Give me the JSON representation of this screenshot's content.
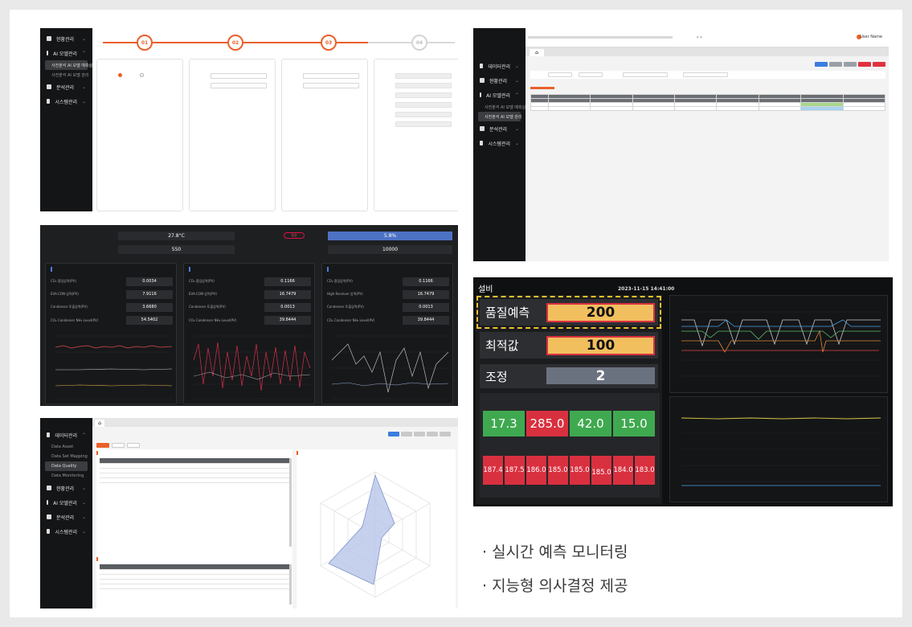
{
  "panel_a": {
    "sidebar": [
      {
        "label": "현황관리"
      },
      {
        "label": "AI 모델관리"
      },
      {
        "label": "분석관리"
      },
      {
        "label": "시스템관리"
      }
    ],
    "sidebar_sub": [
      "사전분석 AI 모델 예측실",
      "사전분석 AI 모델 관리"
    ],
    "steps": [
      "01",
      "02",
      "03",
      "04"
    ]
  },
  "panel_b": {
    "user_name": "User Name",
    "home_tab": "⌂",
    "sidebar": [
      {
        "label": "데이터관리"
      },
      {
        "label": "현황관리"
      },
      {
        "label": "AI 모델관리"
      },
      {
        "label": "분석관리"
      },
      {
        "label": "시스템관리"
      }
    ],
    "sidebar_sub": [
      "사전분석 AI 모델 예측실",
      "사전분석 AI 모델 관리"
    ]
  },
  "panel_c": {
    "top_values": [
      "27.8°C",
      "550",
      "5.8%",
      "10000"
    ],
    "status_badge": "정상",
    "sections": [
      {
        "values": [
          "0.0034",
          "7.9116",
          "3.6680",
          "54.5402"
        ]
      },
      {
        "values": [
          "0.1166",
          "16.7479",
          "0.0013",
          "39.8444"
        ]
      },
      {
        "values": [
          "0.1166",
          "16.7479",
          "0.0013",
          "39.8444"
        ]
      }
    ],
    "section_labels": [
      [
        "CO₂ 흡입압력(PV)",
        "EVA-CON 압력(PV)",
        "Condenser 토출압력(PV)",
        "CO₂ Condenser NH₃ Level(PV)"
      ],
      [
        "CO₂ 흡입압력(PV)",
        "EVA-CON 압력(PV)",
        "Condenser 토출압력(PV)",
        "CO₂ Condenser NH₃ Level(PV)"
      ],
      [
        "CO₂ 흡입압력(PV)",
        "High Receiver 압력(PV)",
        "Condenser 토출압력(PV)",
        "CO₂ Condenser NH₃ Level(PV)"
      ]
    ]
  },
  "panel_d": {
    "home_tab": "⌂",
    "sidebar": [
      {
        "label": "데이터관리"
      },
      {
        "label": "현황관리"
      },
      {
        "label": "AI 모델관리"
      },
      {
        "label": "분석관리"
      },
      {
        "label": "시스템관리"
      }
    ],
    "sidebar_sub": [
      "Data Asset",
      "Data Set Mapping",
      "Data Quality",
      "Data Monitoring"
    ]
  },
  "panel_e": {
    "title": "설비",
    "timestamp": "2023-11-15 14:41:00",
    "quality_label": "품질예측",
    "quality_value": "200",
    "optimal_label": "최적값",
    "optimal_value": "100",
    "adjust_label": "조정",
    "adjust_value": "2",
    "green_values": [
      "17.3",
      "285.0",
      "42.0",
      "15.0"
    ],
    "red_values": [
      "187.4",
      "187.5",
      "186.0",
      "185.0",
      "185.0",
      "185.0",
      "184.0",
      "183.0"
    ]
  },
  "bullets": [
    "· 실시간 예측 모니터링",
    "· 지능형 의사결정 제공"
  ],
  "colors": {
    "accent_orange": "#e9602a",
    "quality_box": "#f2bf5e",
    "adjust_box": "#6a7280",
    "green_cell": "#3fa94f",
    "red_cell": "#d9303f"
  }
}
